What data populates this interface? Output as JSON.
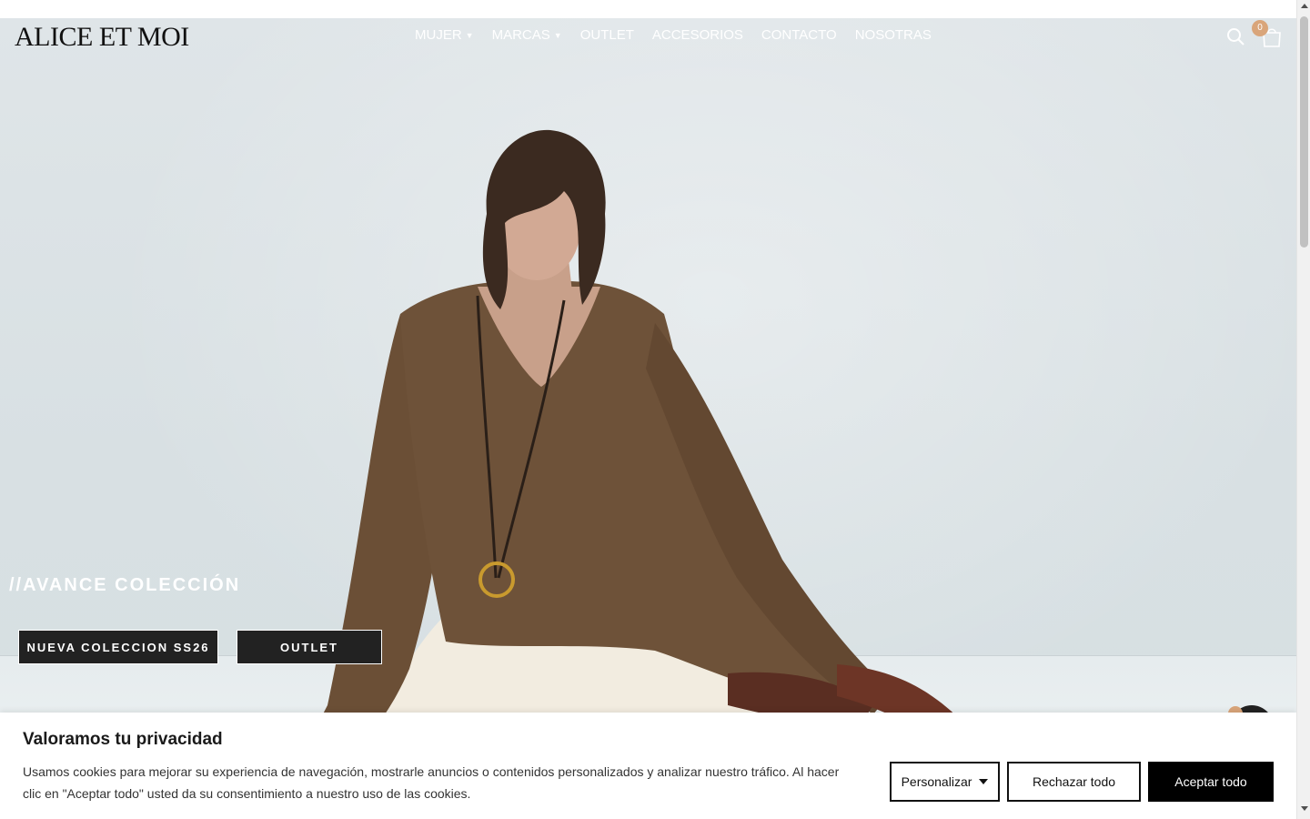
{
  "header": {
    "logo": "ALICE ET MOI",
    "nav": [
      {
        "label": "MUJER",
        "has_dropdown": true
      },
      {
        "label": "MARCAS",
        "has_dropdown": true
      },
      {
        "label": "OUTLET",
        "has_dropdown": false
      },
      {
        "label": "ACCESORIOS",
        "has_dropdown": false
      },
      {
        "label": "CONTACTO",
        "has_dropdown": false
      },
      {
        "label": "NOSOTRAS",
        "has_dropdown": false
      }
    ],
    "cart_count": "0",
    "icons": {
      "search": "search-icon",
      "cart": "shopping-bag-icon",
      "dropdown": "chevron-down-icon"
    }
  },
  "hero": {
    "heading": "//AVANCE COLECCIÓN",
    "cta_primary": "NUEVA COLECCION SS26",
    "cta_secondary": "OUTLET"
  },
  "cookie_banner": {
    "title": "Valoramos tu privacidad",
    "text": "Usamos cookies para mejorar su experiencia de navegación, mostrarle anuncios o contenidos personalizados y analizar nuestro tráfico. Al hacer clic en \"Aceptar todo\" usted da su consentimiento a nuestro uso de las cookies.",
    "customize_label": "Personalizar",
    "reject_label": "Rechazar todo",
    "accept_label": "Aceptar todo"
  },
  "colors": {
    "accent": "#d9a57a",
    "button_dark": "#222222",
    "accept_button": "#000000"
  }
}
